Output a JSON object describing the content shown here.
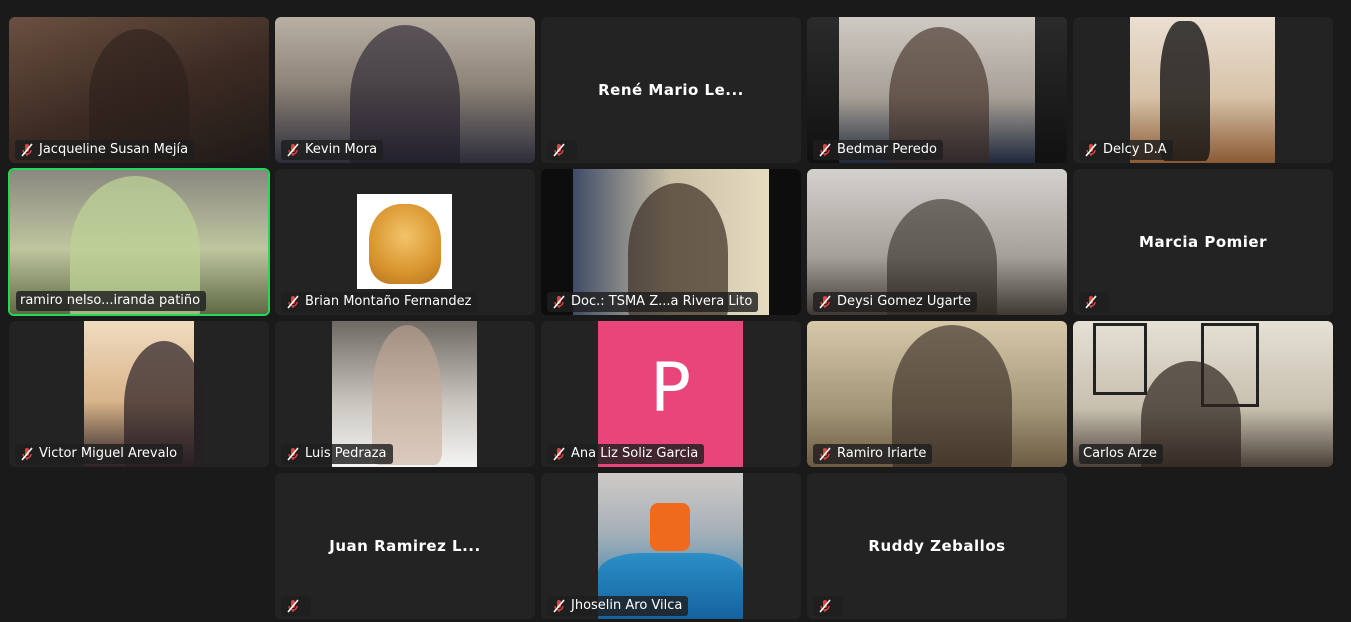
{
  "participants": [
    {
      "name": "Jacqueline Susan Mejía",
      "video": true,
      "muted": true,
      "speaking": false
    },
    {
      "name": "Kevin Mora",
      "video": true,
      "muted": true,
      "speaking": false
    },
    {
      "name": "René Mario Le...",
      "video": false,
      "muted": true,
      "speaking": false
    },
    {
      "name": "Bedmar Peredo",
      "video": true,
      "muted": true,
      "speaking": false
    },
    {
      "name": "Delcy D.A",
      "video": true,
      "muted": true,
      "speaking": false
    },
    {
      "name": "ramiro nelso...iranda patiño",
      "video": true,
      "muted": false,
      "speaking": true
    },
    {
      "name": "Brian Montaño Fernandez",
      "video": true,
      "muted": true,
      "speaking": false
    },
    {
      "name": "Doc.: TSMA Z...a Rivera Lito",
      "video": true,
      "muted": true,
      "speaking": false
    },
    {
      "name": "Deysi Gomez Ugarte",
      "video": true,
      "muted": true,
      "speaking": false
    },
    {
      "name": "Marcia Pomier",
      "video": false,
      "muted": true,
      "speaking": false
    },
    {
      "name": "Victor Miguel Arevalo",
      "video": true,
      "muted": true,
      "speaking": false
    },
    {
      "name": "Luis Pedraza",
      "video": true,
      "muted": true,
      "speaking": false
    },
    {
      "name": "Ana Liz Soliz Garcia",
      "video": true,
      "muted": true,
      "speaking": false,
      "avatar_letter": "P"
    },
    {
      "name": "Ramiro Iriarte",
      "video": true,
      "muted": true,
      "speaking": false
    },
    {
      "name": "Carlos Arze",
      "video": true,
      "muted": false,
      "speaking": false
    },
    {
      "name": "Juan Ramirez L...",
      "video": false,
      "muted": true,
      "speaking": false
    },
    {
      "name": "Jhoselin Aro Vilca",
      "video": true,
      "muted": true,
      "speaking": false
    },
    {
      "name": "Ruddy Zeballos",
      "video": false,
      "muted": true,
      "speaking": false
    }
  ],
  "colors": {
    "speaking_border": "#23d959",
    "muted_icon": "#e0433f",
    "tile_bg": "#232323",
    "page_bg": "#1a1a1a",
    "avatar_pink": "#e8467a"
  },
  "icons": {
    "muted": "mic-muted-icon"
  }
}
